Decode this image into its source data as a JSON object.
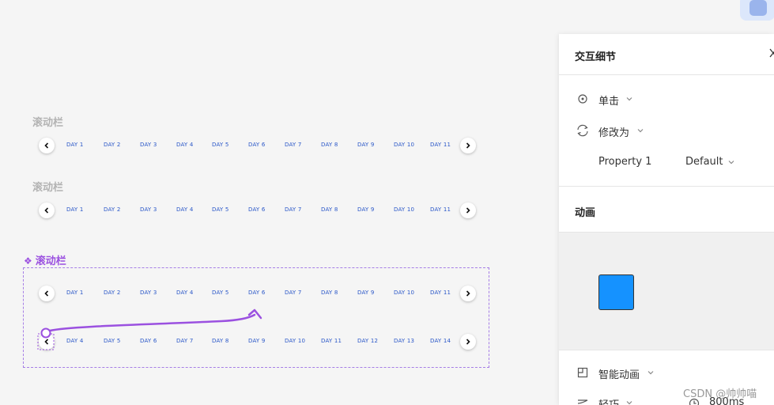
{
  "canvas": {
    "groups": [
      {
        "label": "滚动栏",
        "active": false,
        "rows": [
          {
            "days": [
              "DAY 1",
              "DAY 2",
              "DAY 3",
              "DAY 4",
              "DAY 5",
              "DAY 6",
              "DAY 7",
              "DAY 8",
              "DAY 9",
              "DAY 10",
              "DAY 11"
            ],
            "show_prev": true
          }
        ]
      },
      {
        "label": "滚动栏",
        "active": false,
        "rows": [
          {
            "days": [
              "DAY 1",
              "DAY 2",
              "DAY 3",
              "DAY 4",
              "DAY 5",
              "DAY 6",
              "DAY 7",
              "DAY 8",
              "DAY 9",
              "DAY 10",
              "DAY 11"
            ],
            "show_prev": true
          }
        ]
      },
      {
        "label": "滚动栏",
        "active": true,
        "icon": "component-icon",
        "rows": [
          {
            "days": [
              "DAY 1",
              "DAY 2",
              "DAY 3",
              "DAY 4",
              "DAY 5",
              "DAY 6",
              "DAY 7",
              "DAY 8",
              "DAY 9",
              "DAY 10",
              "DAY 11"
            ],
            "show_prev": true
          },
          {
            "days": [
              "DAY 4",
              "DAY 5",
              "DAY 6",
              "DAY 7",
              "DAY 8",
              "DAY 9",
              "DAY 10",
              "DAY 11",
              "DAY 12",
              "DAY 13",
              "DAY 14"
            ],
            "show_prev": true
          }
        ]
      }
    ],
    "accent_color": "#9b51e0",
    "day_color": "#2a57c8"
  },
  "panel": {
    "title": "交互细节",
    "trigger": {
      "icon": "target-icon",
      "label": "单击"
    },
    "action": {
      "icon": "swap-icon",
      "label": "修改为"
    },
    "property": {
      "name": "Property 1",
      "value": "Default"
    },
    "animation_title": "动画",
    "preview_color": "#1592ff",
    "animation_type": {
      "icon": "smart-animate-icon",
      "label": "智能动画"
    },
    "easing": {
      "icon": "easing-icon",
      "label": "轻巧",
      "duration_icon": "clock-icon",
      "duration": "800ms"
    }
  },
  "watermark": "CSDN @帅帅喵"
}
